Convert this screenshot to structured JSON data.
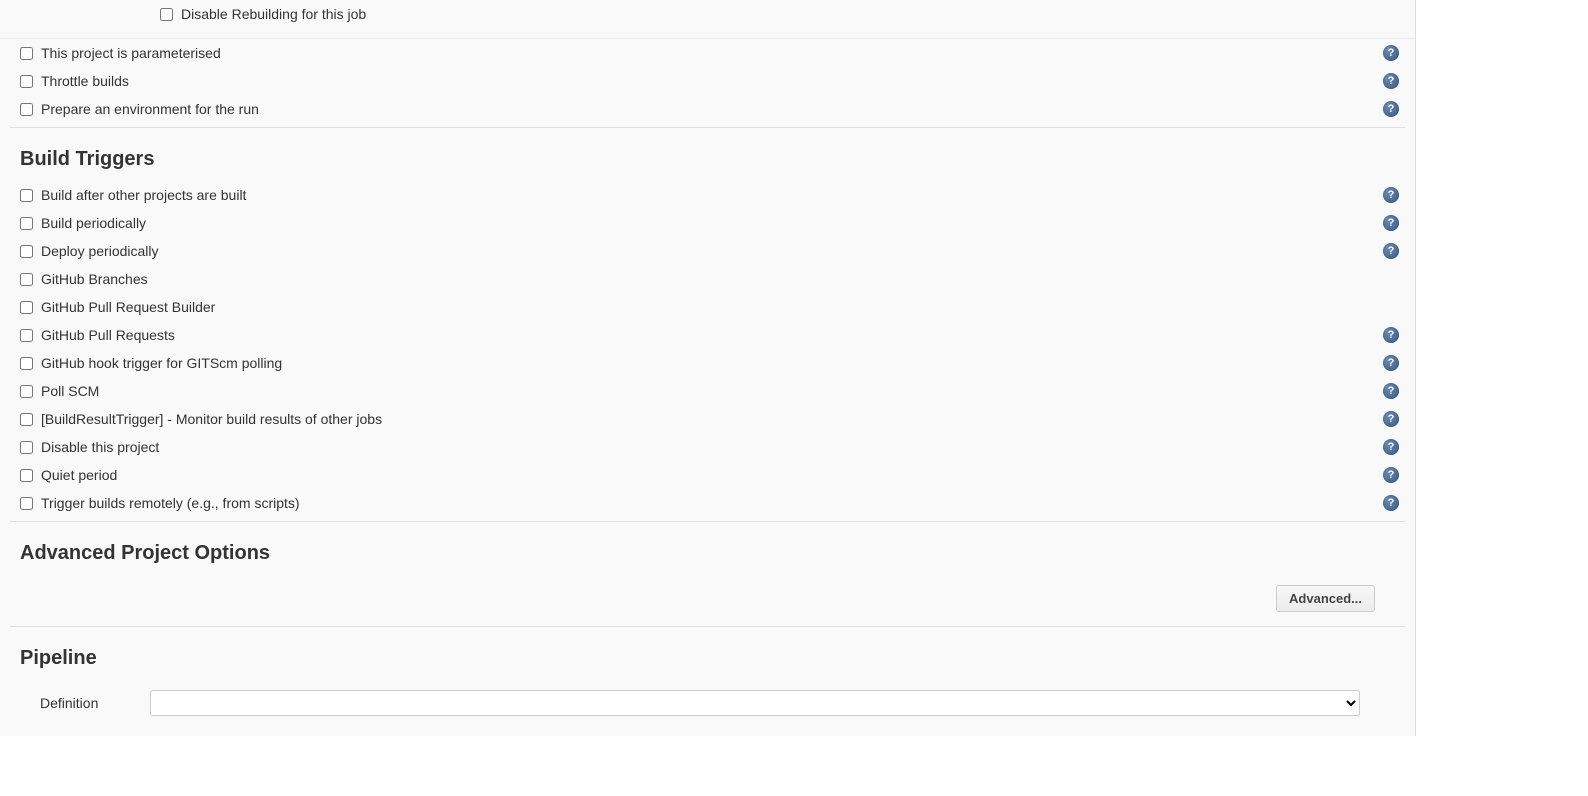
{
  "general": {
    "disable_rebuilding": "Disable Rebuilding for this job",
    "parameterised": "This project is parameterised",
    "throttle": "Throttle builds",
    "prepare_env": "Prepare an environment for the run"
  },
  "build_triggers": {
    "title": "Build Triggers",
    "items": [
      {
        "label": "Build after other projects are built",
        "help": true
      },
      {
        "label": "Build periodically",
        "help": true
      },
      {
        "label": "Deploy periodically",
        "help": true
      },
      {
        "label": "GitHub Branches",
        "help": false
      },
      {
        "label": "GitHub Pull Request Builder",
        "help": false
      },
      {
        "label": "GitHub Pull Requests",
        "help": true
      },
      {
        "label": "GitHub hook trigger for GITScm polling",
        "help": true
      },
      {
        "label": "Poll SCM",
        "help": true
      },
      {
        "label": "[BuildResultTrigger] - Monitor build results of other jobs",
        "help": true
      },
      {
        "label": "Disable this project",
        "help": true
      },
      {
        "label": "Quiet period",
        "help": true
      },
      {
        "label": "Trigger builds remotely (e.g., from scripts)",
        "help": true
      }
    ]
  },
  "advanced": {
    "title": "Advanced Project Options",
    "button": "Advanced..."
  },
  "pipeline": {
    "title": "Pipeline",
    "definition_label": "Definition"
  }
}
